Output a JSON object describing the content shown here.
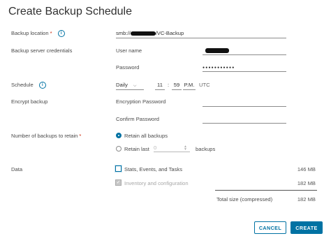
{
  "dialog": {
    "title": "Create Backup Schedule"
  },
  "backup_location": {
    "label": "Backup location",
    "required_mark": "*",
    "value_prefix": "smb://",
    "value_suffix": "/VC-Backup"
  },
  "credentials": {
    "label": "Backup server credentials",
    "username_label": "User name",
    "password_label": "Password",
    "password_mask": "●●●●●●●●●●●"
  },
  "schedule": {
    "label": "Schedule",
    "frequency": "Daily",
    "hour": "11",
    "separator": ":",
    "minute": "59",
    "ampm": "P.M.",
    "timezone": "UTC"
  },
  "encrypt": {
    "label": "Encrypt backup",
    "password_label": "Encryption Password",
    "confirm_label": "Confirm Password"
  },
  "retain": {
    "label": "Number of backups to retain",
    "required_mark": "*",
    "option_all": "Retain all backups",
    "option_last": "Retain last",
    "last_value": "0",
    "backups_suffix": "backups"
  },
  "data": {
    "label": "Data",
    "items": [
      {
        "label": "Stats, Events, and Tasks",
        "size": "146 MB",
        "checked": false,
        "disabled": false
      },
      {
        "label": "Inventory and configuration",
        "size": "182 MB",
        "checked": true,
        "disabled": true
      }
    ],
    "total_label": "Total size (compressed)",
    "total_size": "182 MB"
  },
  "icons": {
    "info": "info-icon",
    "select": "chevron-down-icon",
    "stepper": "stepper-icon",
    "check": "checkmark-icon"
  },
  "colors": {
    "accent": "#0072a3",
    "required": "#c92100"
  },
  "buttons": {
    "cancel": "CANCEL",
    "create": "CREATE"
  }
}
